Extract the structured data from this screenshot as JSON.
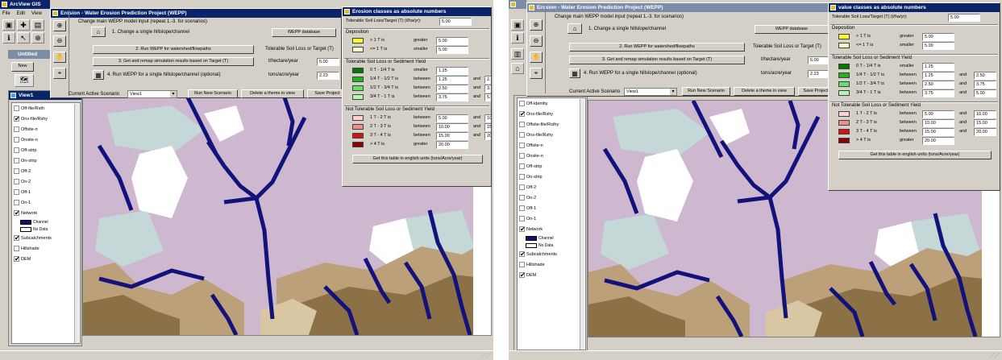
{
  "app": {
    "arcview_title": "ArcView GIS",
    "wepp_title": "Erosion - Water Erosion Prediction Project (WEPP)",
    "legend_title_left": "Erosion classes as absolute numbers",
    "legend_title_right": "value classes as absolute numbers",
    "menu": [
      "File",
      "Edit",
      "View"
    ],
    "new_label": "New",
    "view_window_title": "View1",
    "project_window_title": "Untitled"
  },
  "toc_left": [
    {
      "label": "Off-file/Rsth",
      "checked": false
    },
    {
      "label": "Ons-file/Rshy",
      "checked": true
    },
    {
      "label": "Offsite-n",
      "checked": false
    },
    {
      "label": "Onsite-n",
      "checked": false
    },
    {
      "label": "Off-strip",
      "checked": false
    },
    {
      "label": "On-strip",
      "checked": false
    },
    {
      "label": "Off-2",
      "checked": false
    },
    {
      "label": "On-2",
      "checked": false
    },
    {
      "label": "Off-1",
      "checked": false
    },
    {
      "label": "On-1",
      "checked": false
    },
    {
      "label": "Network",
      "checked": true,
      "sub": [
        "Channel",
        "No Data"
      ]
    },
    {
      "label": "Subcatchments",
      "checked": true
    },
    {
      "label": "Hillshade",
      "checked": false
    },
    {
      "label": "DEM",
      "checked": true
    }
  ],
  "toc_right": [
    {
      "label": "Off-identity",
      "checked": false
    },
    {
      "label": "Ons-file/Rshy",
      "checked": true
    },
    {
      "label": "Offsite-file/Rsthy",
      "checked": false
    },
    {
      "label": "Ons-file/Rshy",
      "checked": false
    },
    {
      "label": "Offsite-n",
      "checked": false
    },
    {
      "label": "Onsite-n",
      "checked": false
    },
    {
      "label": "Off-strip",
      "checked": false
    },
    {
      "label": "On-strip",
      "checked": false
    },
    {
      "label": "Off-2",
      "checked": false
    },
    {
      "label": "On-2",
      "checked": false
    },
    {
      "label": "Off-1",
      "checked": false
    },
    {
      "label": "On-1",
      "checked": false
    },
    {
      "label": "Network",
      "checked": true,
      "sub": [
        "Channel",
        "No Data"
      ]
    },
    {
      "label": "Subcatchments",
      "checked": true
    },
    {
      "label": "Hillshade",
      "checked": false
    },
    {
      "label": "DEM",
      "checked": true
    }
  ],
  "wepp": {
    "header": "Change main WEPP model input (repeat 1.-3. for scenarios)",
    "step1": "1. Change a single hillslope/channel",
    "step2": "2. Run WEPP for watershed/flowpaths",
    "step3": "3. Get and remap simulation results based on Target (T)",
    "step4": "4. Run WEPP for a single hillslope/channel (optional)",
    "database_btn": "WEPP database",
    "target_label": "Tolerable Soil Loss or Target (T)",
    "t_ha_label": "t/hectare/year",
    "t_ha_value": "5.00",
    "tons_acre_label": "tons/acre/year",
    "tons_acre_value": "2.23",
    "scenario_label": "Current Active Scenario",
    "scenario_value": "View1",
    "run_new_btn": "Run New Scenario",
    "delete_btn": "Delete a theme in view",
    "save_btn": "Save Project"
  },
  "legend": {
    "tolerable_label": "Tolerable Soil Loss/Target (T) (t/ha/yr):",
    "tolerable_value": "5.00",
    "deposition_hdr": "Deposition",
    "tolerable_hdr": "Tolerable Soil Loss or Sediment Yield",
    "not_tolerable_hdr": "Not Tolerable Soil Loss or Sediment Yield",
    "and_label": "and",
    "rows": [
      {
        "group": "dep",
        "color": "#ffff33",
        "desc": "> 1 T is",
        "op": "greater",
        "v1": "5.00",
        "v2": ""
      },
      {
        "group": "dep",
        "color": "#ffffc8",
        "desc": "<= 1 T is",
        "op": "smaller",
        "v1": "5.00",
        "v2": ""
      },
      {
        "group": "tol",
        "color": "#007800",
        "desc": "0 T - 1/4 T is",
        "op": "smaller",
        "v1": "1.25",
        "v2": ""
      },
      {
        "group": "tol",
        "color": "#1fb41f",
        "desc": "1/4 T - 1/2 T is",
        "op": "between",
        "v1": "1.25",
        "v2": "2.50"
      },
      {
        "group": "tol",
        "color": "#66e066",
        "desc": "1/2 T - 3/4 T is",
        "op": "between",
        "v1": "2.50",
        "v2": "3.75"
      },
      {
        "group": "tol",
        "color": "#b4f5b4",
        "desc": "3/4 T - 1 T is",
        "op": "between",
        "v1": "3.75",
        "v2": "5.00"
      },
      {
        "group": "not",
        "color": "#ffd2d2",
        "desc": "1 T - 2 T is",
        "op": "between",
        "v1": "5.00",
        "v2": "10.00"
      },
      {
        "group": "not",
        "color": "#f08c8c",
        "desc": "2 T - 3 T is",
        "op": "between",
        "v1": "10.00",
        "v2": "15.00"
      },
      {
        "group": "not",
        "color": "#d21414",
        "desc": "3 T - 4 T is",
        "op": "between",
        "v1": "15.00",
        "v2": "20.00"
      },
      {
        "group": "not",
        "color": "#8c0000",
        "desc": "> 4 T is",
        "op": "greater",
        "v1": "20.00",
        "v2": ""
      }
    ],
    "english_btn": "Get this table in english units (tons/Acre/year)"
  },
  "colors": {
    "titlebar": "#0a246a",
    "window_face": "#d4d0c8",
    "land_pink": "#cdb8cf",
    "land_tan": "#bca07a",
    "land_brown": "#8c7046",
    "land_light": "#d9c7a4",
    "stream": "#12127a",
    "whitebg": "#ffffff",
    "pale_blue": "#c4d8d8"
  }
}
